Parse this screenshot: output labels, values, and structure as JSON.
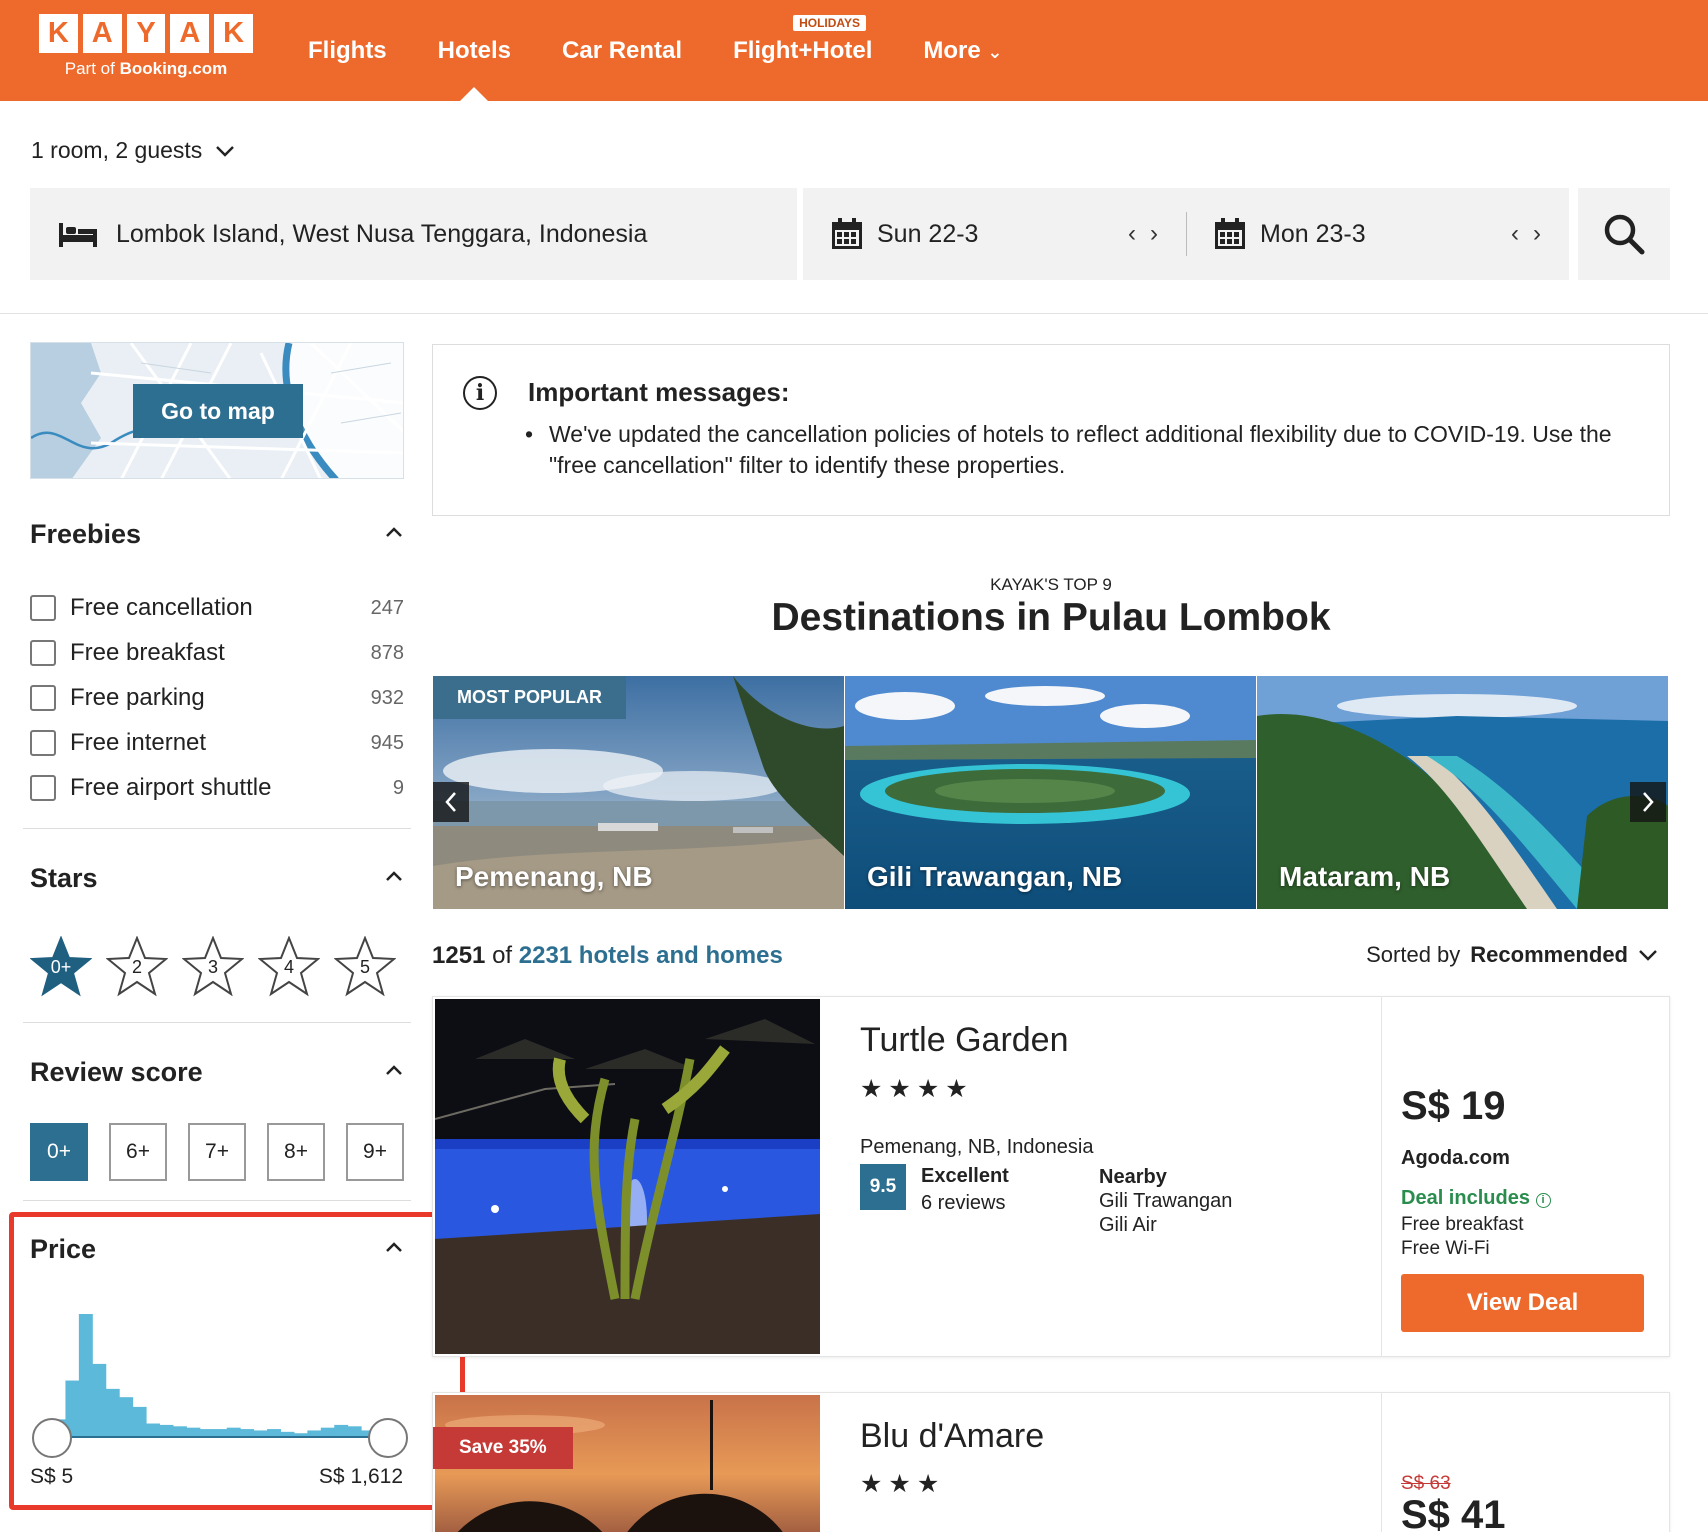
{
  "header": {
    "logo_letters": [
      "K",
      "A",
      "Y",
      "A",
      "K"
    ],
    "logo_sub_prefix": "Part of",
    "logo_sub_brand": "Booking.com",
    "nav": [
      {
        "label": "Flights"
      },
      {
        "label": "Hotels",
        "active": true
      },
      {
        "label": "Car Rental"
      },
      {
        "label": "Flight+Hotel",
        "badge": "HOLIDAYS"
      },
      {
        "label": "More"
      }
    ]
  },
  "search": {
    "guests": "1 room, 2 guests",
    "location": "Lombok Island, West Nusa Tenggara, Indonesia",
    "checkin": "Sun 22-3",
    "checkout": "Mon 23-3"
  },
  "sidebar": {
    "map_button": "Go to map",
    "freebies": {
      "title": "Freebies",
      "items": [
        {
          "label": "Free cancellation",
          "count": "247"
        },
        {
          "label": "Free breakfast",
          "count": "878"
        },
        {
          "label": "Free parking",
          "count": "932"
        },
        {
          "label": "Free internet",
          "count": "945"
        },
        {
          "label": "Free airport shuttle",
          "count": "9"
        }
      ]
    },
    "stars": {
      "title": "Stars",
      "options": [
        "0+",
        "2",
        "3",
        "4",
        "5"
      ],
      "selected": "0+"
    },
    "review_score": {
      "title": "Review score",
      "options": [
        "0+",
        "6+",
        "7+",
        "8+",
        "9+"
      ],
      "selected": "0+"
    },
    "price": {
      "title": "Price",
      "min_label": "S$ 5",
      "max_label": "S$ 1,612",
      "histogram": [
        12,
        40,
        88,
        52,
        34,
        28,
        21,
        9,
        8,
        7,
        6,
        5,
        5,
        6,
        5,
        4,
        5,
        3,
        2,
        4,
        6,
        8,
        7,
        4,
        2
      ]
    }
  },
  "messages": {
    "title": "Important messages:",
    "text": "We've updated the cancellation policies of hotels to reflect additional flexibility due to COVID-19. Use the \"free cancellation\" filter to identify these properties."
  },
  "top9": {
    "subtitle": "KAYAK'S TOP 9",
    "title": "Destinations in Pulau Lombok",
    "badge": "MOST POPULAR",
    "destinations": [
      "Pemenang, NB",
      "Gili Trawangan, NB",
      "Mataram, NB"
    ]
  },
  "results": {
    "count": "1251",
    "of": "of",
    "total": "2231 hotels and homes",
    "sorted_label": "Sorted by",
    "sorted_value": "Recommended"
  },
  "hotels": [
    {
      "name": "Turtle Garden",
      "stars": "★★★★",
      "location": "Pemenang, NB, Indonesia",
      "score": "9.5",
      "rating_word": "Excellent",
      "reviews": "6 reviews",
      "nearby_title": "Nearby",
      "nearby": [
        "Gili Trawangan",
        "Gili Air"
      ],
      "price": "S$ 19",
      "agency": "Agoda.com",
      "deal_title": "Deal includes",
      "deal_items": [
        "Free breakfast",
        "Free Wi-Fi"
      ],
      "button": "View Deal"
    },
    {
      "name": "Blu d'Amare",
      "stars": "★★★",
      "save_badge": "Save 35%",
      "old_price": "S$ 63",
      "price": "S$ 41"
    }
  ],
  "colors": {
    "brand_orange": "#ee6a2c",
    "accent_blue": "#2d6f90",
    "deal_green": "#2a8d4e",
    "highlight_red": "#e8392b"
  }
}
